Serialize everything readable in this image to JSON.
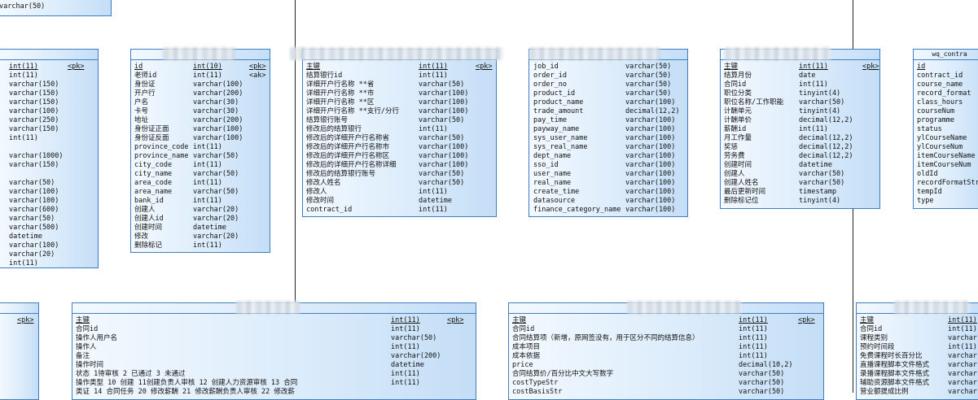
{
  "diagram": {
    "entities": [
      {
        "id": "e0",
        "header": "",
        "cols": [
          4,
          0,
          0
        ],
        "rows": [
          {
            "n": "",
            "t": "varchar(50)"
          },
          {
            "n": "",
            "t": "varchar(50)"
          }
        ]
      },
      {
        "id": "e1",
        "header": "",
        "cols": [
          12,
          0,
          84
        ],
        "rows": [
          {
            "n": "int(11)",
            "t": "",
            "k": "<pk>",
            "u": true
          },
          {
            "n": "int(11)",
            "t": ""
          },
          {
            "n": "varchar(150)",
            "t": ""
          },
          {
            "n": "varchar(150)",
            "t": ""
          },
          {
            "n": "varchar(150)",
            "t": ""
          },
          {
            "n": "varchar(100)",
            "t": ""
          },
          {
            "n": "varchar(250)",
            "t": ""
          },
          {
            "n": "varchar(150)",
            "t": ""
          },
          {
            "n": "int(11)",
            "t": ""
          },
          {
            "n": "",
            "t": ""
          },
          {
            "n": "varchar(1000)",
            "t": ""
          },
          {
            "n": "varchar(150)",
            "t": ""
          },
          {
            "n": "",
            "t": ""
          },
          {
            "n": "varchar(50)",
            "t": ""
          },
          {
            "n": "varchar(100)",
            "t": ""
          },
          {
            "n": "varchar(100)",
            "t": ""
          },
          {
            "n": "varchar(600)",
            "t": ""
          },
          {
            "n": "varchar(50)",
            "t": ""
          },
          {
            "n": "varchar(500)",
            "t": ""
          },
          {
            "n": "datetime",
            "t": ""
          },
          {
            "n": "varchar(100)",
            "t": ""
          },
          {
            "n": "varchar(20)",
            "t": ""
          },
          {
            "n": "int(11)",
            "t": ""
          }
        ]
      },
      {
        "id": "e2",
        "header": "",
        "cols": [
          4,
          76,
          145
        ],
        "rows": [
          {
            "n": "id",
            "t": "int(10)",
            "k": "<pk>",
            "u": true
          },
          {
            "n": "老师id",
            "t": "int(11)",
            "k": "<ak>"
          },
          {
            "n": "身份证",
            "t": "varchar(100)"
          },
          {
            "n": "开户行",
            "t": "varchar(200)"
          },
          {
            "n": "户名",
            "t": "varchar(30)"
          },
          {
            "n": "卡号",
            "t": "varchar(30)"
          },
          {
            "n": "地址",
            "t": "varchar(200)"
          },
          {
            "n": "身份证正面",
            "t": "varchar(100)"
          },
          {
            "n": "身份证反面",
            "t": "varchar(100)"
          },
          {
            "n": "province_code",
            "t": "int(11)"
          },
          {
            "n": "province_name",
            "t": "varchar(50)"
          },
          {
            "n": "city_code",
            "t": "int(11)"
          },
          {
            "n": "city_name",
            "t": "varchar(50)"
          },
          {
            "n": "area_code",
            "t": "int(11)"
          },
          {
            "n": "area_name",
            "t": "varchar(50)"
          },
          {
            "n": "bank_id",
            "t": "int(11)"
          },
          {
            "n": "创建人",
            "t": "varchar(20)"
          },
          {
            "n": "创建人id",
            "t": "varchar(20)"
          },
          {
            "n": "创建时间",
            "t": "datetime"
          },
          {
            "n": "修改",
            "t": "varchar(20)"
          },
          {
            "n": "删除标记",
            "t": "int(11)"
          }
        ]
      },
      {
        "id": "e3",
        "header": "",
        "cols": [
          4,
          142,
          212
        ],
        "rows": [
          {
            "n": "主键",
            "t": "int(11)",
            "k": "<pk>",
            "u": true
          },
          {
            "n": "结算银行id",
            "t": "int(11)"
          },
          {
            "n": "详细开户行名称 **省",
            "t": "varchar(50)"
          },
          {
            "n": "详细开户行名称 **市",
            "t": "varchar(100)"
          },
          {
            "n": "详细开户行名称 **区",
            "t": "varchar(100)"
          },
          {
            "n": "详细开户行名称 **支行/分行",
            "t": "varchar(100)"
          },
          {
            "n": "结算银行账号",
            "t": "varchar(50)"
          },
          {
            "n": "修改后的结算银行",
            "t": "int(11)"
          },
          {
            "n": "修改后的详细开户行名称省",
            "t": "varchar(50)"
          },
          {
            "n": "修改后的详细开户行名称市",
            "t": "varchar(100)"
          },
          {
            "n": "修改后的详细开户行名称区",
            "t": "varchar(100)"
          },
          {
            "n": "修改后的详细开户行名称详细",
            "t": "varchar(100)"
          },
          {
            "n": "修改后的结算银行账号",
            "t": "varchar(50)"
          },
          {
            "n": "修改人姓名",
            "t": "varchar(50)"
          },
          {
            "n": "修改人",
            "t": "int(11)"
          },
          {
            "n": "修改时间",
            "t": "datetime"
          },
          {
            "n": "contract_id",
            "t": "int(11)"
          }
        ]
      },
      {
        "id": "e4",
        "header": "",
        "cols": [
          5,
          118,
          0
        ],
        "rows": [
          {
            "n": "job_id",
            "t": "varchar(50)"
          },
          {
            "n": "order_id",
            "t": "varchar(50)"
          },
          {
            "n": "order_no",
            "t": "varchar(50)"
          },
          {
            "n": "product_id",
            "t": "varchar(50)"
          },
          {
            "n": "product_name",
            "t": "varchar(100)"
          },
          {
            "n": "trade_amount",
            "t": "decimal(12,2)"
          },
          {
            "n": "pay_time",
            "t": "varchar(100)"
          },
          {
            "n": "payway_name",
            "t": "varchar(100)"
          },
          {
            "n": "sys_user_name",
            "t": "varchar(100)"
          },
          {
            "n": "sys_real_name",
            "t": "varchar(100)"
          },
          {
            "n": "dept_name",
            "t": "varchar(100)"
          },
          {
            "n": "sso_id",
            "t": "varchar(100)"
          },
          {
            "n": "user_name",
            "t": "varchar(100)"
          },
          {
            "n": "real_name",
            "t": "varchar(100)"
          },
          {
            "n": "create_time",
            "t": "varchar(100)"
          },
          {
            "n": "datasource",
            "t": "varchar(100)"
          },
          {
            "n": "finance_category_name",
            "t": "varchar(100)"
          }
        ]
      },
      {
        "id": "e5",
        "header": "",
        "cols": [
          4,
          96,
          174
        ],
        "rows": [
          {
            "n": "主键",
            "t": "int(11)",
            "k": "<pk>",
            "u": true
          },
          {
            "n": "结算月份",
            "t": "date"
          },
          {
            "n": "合同id",
            "t": "int(11)"
          },
          {
            "n": "职位分类",
            "t": "tinyint(4)"
          },
          {
            "n": "职位名称/工作职能",
            "t": "varchar(50)"
          },
          {
            "n": "计酬单元",
            "t": "tinyint(4)"
          },
          {
            "n": "计酬单价",
            "t": "decimal(12,2)"
          },
          {
            "n": "薪酬id",
            "t": "int(11)"
          },
          {
            "n": "月工作量",
            "t": "decimal(12,2)"
          },
          {
            "n": "奖惩",
            "t": "decimal(12,2)"
          },
          {
            "n": "劳务费",
            "t": "decimal(12,2)"
          },
          {
            "n": "创建时间",
            "t": "datetime"
          },
          {
            "n": "创建人",
            "t": "varchar(50)"
          },
          {
            "n": "创建人姓名",
            "t": "varchar(50)"
          },
          {
            "n": "最后更新时间",
            "t": "timestamp"
          },
          {
            "n": "删除标记位",
            "t": "tinyint(4)"
          }
        ]
      },
      {
        "id": "e6",
        "header": "wq_contra",
        "cols": [
          4,
          0,
          0
        ],
        "rows": [
          {
            "n": "id",
            "t": "",
            "u": true
          },
          {
            "n": "contract_id",
            "t": ""
          },
          {
            "n": "course_name",
            "t": ""
          },
          {
            "n": "record_format",
            "t": ""
          },
          {
            "n": "class_hours",
            "t": ""
          },
          {
            "n": "courseNum",
            "t": ""
          },
          {
            "n": "programme",
            "t": ""
          },
          {
            "n": "status",
            "t": ""
          },
          {
            "n": "ylCourseName",
            "t": ""
          },
          {
            "n": "ylCourseNum",
            "t": ""
          },
          {
            "n": "itemCourseName",
            "t": ""
          },
          {
            "n": "itemCourseNum",
            "t": ""
          },
          {
            "n": "oldId",
            "t": ""
          },
          {
            "n": "recordFormatStr",
            "t": ""
          },
          {
            "n": "tempId",
            "t": ""
          },
          {
            "n": "type",
            "t": ""
          }
        ]
      },
      {
        "id": "e7",
        "header": "",
        "cols": [
          4,
          0,
          22
        ],
        "rows": [
          {
            "n": "",
            "t": "",
            "k": "<pk>",
            "u": true
          }
        ]
      },
      {
        "id": "e8",
        "header": "",
        "cols": [
          4,
          391,
          460
        ],
        "rows": [
          {
            "n": "主键",
            "t": "int(11)",
            "k": "<pk>",
            "u": true
          },
          {
            "n": "合同id",
            "t": "int(11)"
          },
          {
            "n": "操作人用户名",
            "t": "varchar(50)"
          },
          {
            "n": "操作人",
            "t": "int(11)"
          },
          {
            "n": "备注",
            "t": "varchar(200)"
          },
          {
            "n": "操作时间",
            "t": "datetime"
          },
          {
            "n": "状态 1待审核 2 已通过 3 未通过",
            "t": "int(11)"
          },
          {
            "n": "操作类型  10 创建  11创建负责人审核 12 创建人力资源审核 13 合同",
            "t": "int(11)"
          },
          {
            "n": "类证 14 合同任务  20 修改薪酬  21 修改薪酬负责人审核 22 修改薪",
            "t": ""
          }
        ]
      },
      {
        "id": "e9",
        "header": "",
        "cols": [
          4,
          282,
          355
        ],
        "rows": [
          {
            "n": "主键",
            "t": "int(11)",
            "k": "<pk>",
            "u": true
          },
          {
            "n": "合同id",
            "t": "int(11)"
          },
          {
            "n": "合同结算项（新增，原网签没有，用于区分不同的结算信息）",
            "t": "int(11)"
          },
          {
            "n": "成本项目",
            "t": "int(11)"
          },
          {
            "n": "成本依据",
            "t": "int(11)"
          },
          {
            "n": "price",
            "t": "decimal(10,2)"
          },
          {
            "n": "合同结算价/百分比中文大写数字",
            "t": "varchar(50)"
          },
          {
            "n": "costTypeStr",
            "t": "varchar(50)"
          },
          {
            "n": "costBasisStr",
            "t": "varchar(50)"
          }
        ]
      },
      {
        "id": "e10",
        "header": "",
        "cols": [
          4,
          112,
          0
        ],
        "rows": [
          {
            "n": "主键",
            "t": "int(11)",
            "u": true
          },
          {
            "n": "合同id",
            "t": "int(11)"
          },
          {
            "n": "课程类别",
            "t": "varchar"
          },
          {
            "n": "预约时间段",
            "t": "int(11)"
          },
          {
            "n": "免费课程时长百分比",
            "t": "varchar"
          },
          {
            "n": "直播课程脚本文件格式",
            "t": "varchar"
          },
          {
            "n": "录播课程脚本文件格式",
            "t": "varchar"
          },
          {
            "n": "辅助资源脚本文件格式",
            "t": "varchar"
          },
          {
            "n": "营业额提成比例",
            "t": "varchar"
          }
        ]
      }
    ]
  }
}
